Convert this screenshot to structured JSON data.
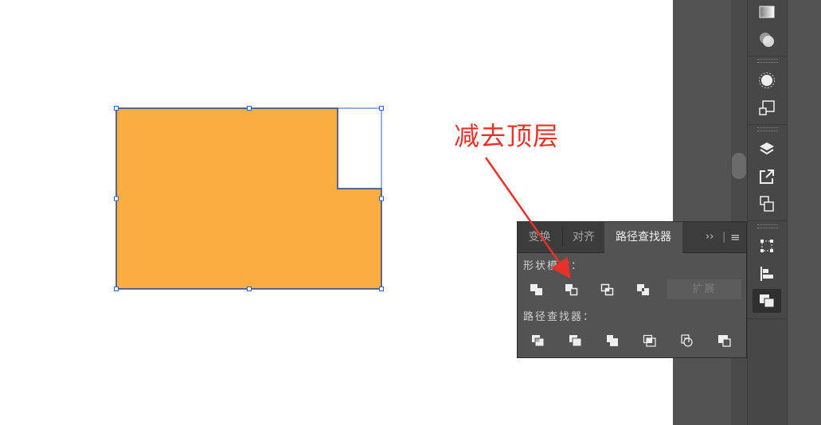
{
  "annotation": {
    "text": "减去顶层"
  },
  "colors": {
    "shape_fill": "#f9ae3f",
    "selection": "#2b65d1",
    "annotation_red": "#e8312a"
  },
  "pathfinder_panel": {
    "tabs": [
      {
        "label": "变换",
        "active": false
      },
      {
        "label": "对齐",
        "active": false
      },
      {
        "label": "路径查找器",
        "active": true
      }
    ],
    "overflow_label": "››",
    "divider_label": "|",
    "menu_label": "≡",
    "shape_modes": {
      "label": "形状模式：",
      "buttons": [
        "unite-icon",
        "minus-front-icon",
        "intersect-icon",
        "exclude-icon"
      ],
      "expand_label": "扩展"
    },
    "pathfinders": {
      "label": "路径查找器：",
      "buttons": [
        "divide-icon",
        "trim-icon",
        "merge-icon",
        "crop-icon",
        "outline-icon",
        "minus-back-icon"
      ]
    }
  },
  "icon_bar": [
    "gradient-icon",
    "transparency-icon",
    "brushes-icon",
    "artboards-icon",
    "layers-icon",
    "export-icon",
    "links-icon",
    "transform-icon",
    "align-icon",
    "pathfinder-icon"
  ]
}
